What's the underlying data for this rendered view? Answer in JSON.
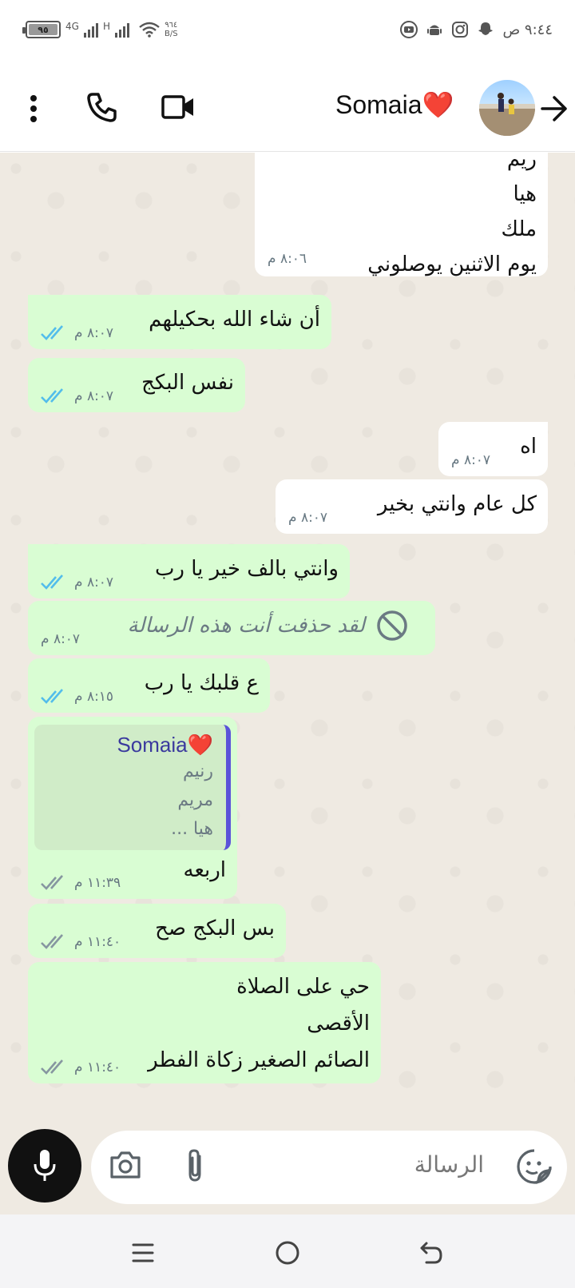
{
  "status_bar": {
    "battery": "٩٥",
    "network_1": "4G",
    "network_2": "H",
    "speed_value": "٩٦٤",
    "speed_unit": "B/S",
    "clock": "٩:٤٤ ص"
  },
  "header": {
    "contact_name": "Somaia❤️"
  },
  "messages": [
    {
      "dir": "in",
      "lines": [
        "ريم",
        "هيا",
        "ملك",
        "يوم الاثنين يوصلوني"
      ],
      "time": "٨:٠٦ م"
    },
    {
      "dir": "out",
      "lines": [
        "أن شاء الله بحكيلهم"
      ],
      "time": "٨:٠٧ م",
      "ticks": "read"
    },
    {
      "dir": "out",
      "lines": [
        "نفس البكج"
      ],
      "time": "٨:٠٧ م",
      "ticks": "read"
    },
    {
      "dir": "in",
      "lines": [
        "اه"
      ],
      "time": "٨:٠٧ م"
    },
    {
      "dir": "in",
      "lines": [
        "كل عام وانتي بخير"
      ],
      "time": "٨:٠٧ م"
    },
    {
      "dir": "out",
      "lines": [
        "وانتي بالف خير يا رب"
      ],
      "time": "٨:٠٧ م",
      "ticks": "read"
    },
    {
      "dir": "out",
      "lines": [
        "لقد حذفت أنت هذه الرسالة"
      ],
      "time": "٨:٠٧ م",
      "deleted": true
    },
    {
      "dir": "out",
      "lines": [
        "ع قلبك يا رب"
      ],
      "time": "٨:١٥ م",
      "ticks": "read"
    },
    {
      "dir": "out",
      "reply": {
        "name": "Somaia❤️",
        "lines": [
          "رنيم",
          "مريم",
          "هيا ..."
        ]
      },
      "lines": [
        "اربعه"
      ],
      "time": "١١:٣٩ م",
      "ticks": "delivered"
    },
    {
      "dir": "out",
      "lines": [
        "بس البكج صح"
      ],
      "time": "١١:٤٠ م",
      "ticks": "delivered"
    },
    {
      "dir": "out",
      "lines": [
        "حي على الصلاة",
        "الأقصى",
        "الصائم الصغير زكاة الفطر"
      ],
      "time": "١١:٤٠ م",
      "ticks": "delivered"
    }
  ],
  "input": {
    "placeholder": "الرسالة"
  },
  "colors": {
    "bubble_out": "#d9fdd3",
    "bubble_in": "#ffffff",
    "chat_bg": "#efeae2",
    "read_ticks": "#53bdeb",
    "delivered_ticks": "#8696a0"
  }
}
